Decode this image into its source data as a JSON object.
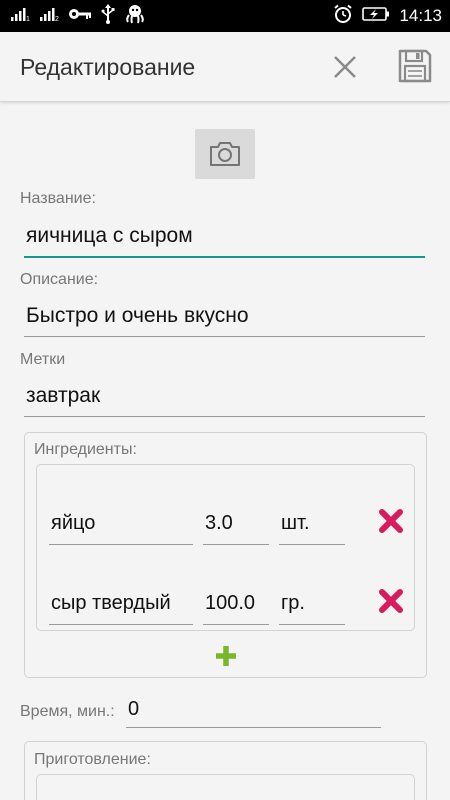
{
  "status_bar": {
    "time": "14:13",
    "icons": [
      "signal-icon",
      "signal-2-icon",
      "key-icon",
      "usb-icon",
      "octopus-icon",
      "alarm-icon",
      "battery-charging-icon"
    ]
  },
  "app_bar": {
    "title": "Редактирование",
    "actions": [
      "close-icon",
      "save-icon"
    ]
  },
  "form": {
    "photo_button": "camera-icon",
    "name_label": "Название:",
    "name_value": "яичница с сыром",
    "description_label": "Описание:",
    "description_value": "Быстро и очень вкусно",
    "tags_label": "Метки",
    "tags_value": "завтрак",
    "ingredients": {
      "title": "Ингредиенты:",
      "items": [
        {
          "name": "яйцо",
          "amount": "3.0",
          "unit": "шт."
        },
        {
          "name": "сыр твердый",
          "amount": "100.0",
          "unit": "гр."
        }
      ]
    },
    "time_label": "Время, мин.:",
    "time_value": "0",
    "preparation_label": "Приготовление:"
  },
  "colors": {
    "accent": "#129a8f",
    "delete": "#d81b60",
    "add": "#76b82a"
  }
}
